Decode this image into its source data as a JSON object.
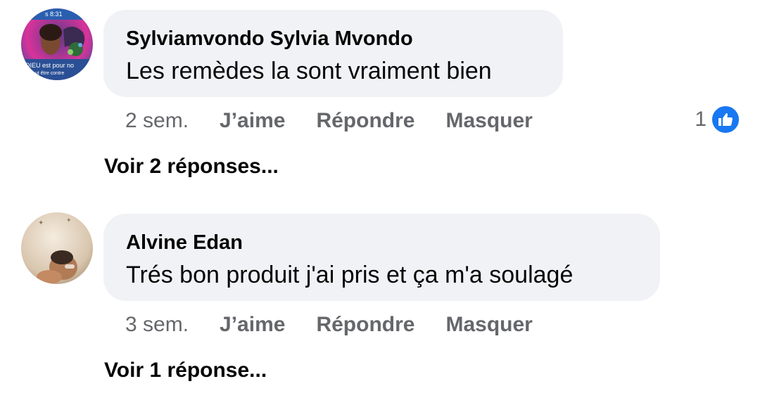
{
  "comments": [
    {
      "author": "Sylviamvondo Sylvia Mvondo",
      "text": "Les remèdes la sont vraiment bien",
      "time": "2 sem.",
      "like_label": "J’aime",
      "reply_label": "Répondre",
      "hide_label": "Masquer",
      "reaction_count": "1",
      "reaction_icon": "like-icon",
      "view_replies": "Voir 2 réponses...",
      "avatar_caption": {
        "top": "s 8:31",
        "line1": "DIEU est pour no",
        "line2": "ut être contre"
      }
    },
    {
      "author": "Alvine Edan",
      "text": "Trés bon produit j'ai pris et ça m'a soulagé",
      "time": "3 sem.",
      "like_label": "J’aime",
      "reply_label": "Répondre",
      "hide_label": "Masquer",
      "view_replies": "Voir 1 réponse..."
    }
  ],
  "colors": {
    "bubble": "#f0f2f5",
    "secondary_text": "#65676b",
    "like_blue": "#1877f2"
  }
}
